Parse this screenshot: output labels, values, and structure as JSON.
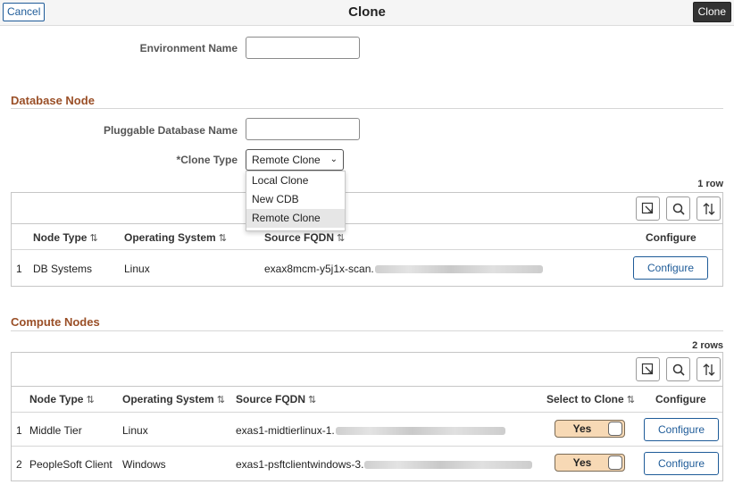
{
  "header": {
    "cancel_label": "Cancel",
    "title": "Clone",
    "clone_label": "Clone"
  },
  "env": {
    "label": "Environment Name",
    "value": ""
  },
  "database_node": {
    "section_title": "Database Node",
    "pdb_label": "Pluggable Database Name",
    "pdb_value": "",
    "clone_type_label": "*Clone Type",
    "clone_type_value": "Remote Clone",
    "clone_type_options": [
      "Local Clone",
      "New CDB",
      "Remote Clone"
    ],
    "row_count": "1 row",
    "columns": [
      "Node Type",
      "Operating System",
      "Source FQDN",
      "Configure"
    ],
    "rows": [
      {
        "num": "1",
        "node_type": "DB Systems",
        "os": "Linux",
        "fqdn": "exax8mcm-y5j1x-scan.",
        "configure": "Configure"
      }
    ]
  },
  "compute_nodes": {
    "section_title": "Compute Nodes",
    "row_count": "2 rows",
    "columns": [
      "Node Type",
      "Operating System",
      "Source FQDN",
      "Select to Clone",
      "Configure"
    ],
    "rows": [
      {
        "num": "1",
        "node_type": "Middle Tier",
        "os": "Linux",
        "fqdn": "exas1-midtierlinux-1.",
        "select": "Yes",
        "configure": "Configure"
      },
      {
        "num": "2",
        "node_type": "PeopleSoft Client",
        "os": "Windows",
        "fqdn": "exas1-psftclientwindows-3.",
        "select": "Yes",
        "configure": "Configure"
      }
    ]
  },
  "icons": {
    "sort": "sort-icon",
    "export": "export-icon",
    "search": "search-icon",
    "reorder": "sort-arrows-icon",
    "chevron": "chevron-down-icon"
  },
  "colors": {
    "section_title": "#9a4f27",
    "link_blue": "#1e5b98",
    "toggle_on": "#f7d9b5"
  }
}
